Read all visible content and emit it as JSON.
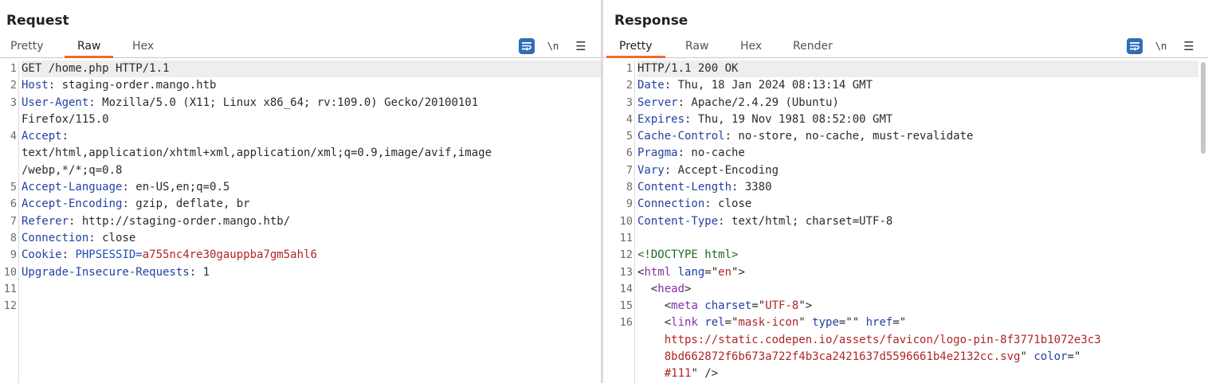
{
  "request": {
    "title": "Request",
    "tabs": [
      "Pretty",
      "Raw",
      "Hex"
    ],
    "active_tab": "Raw",
    "lines": [
      [
        {
          "t": "GET /home.php HTTP/1.1"
        }
      ],
      [
        {
          "t": "Host",
          "c": "hn"
        },
        {
          "t": ": staging-order.mango.htb"
        }
      ],
      [
        {
          "t": "User-Agent",
          "c": "hn"
        },
        {
          "t": ": Mozilla/5.0 (X11; Linux x86_64; rv:109.0) Gecko/20100101"
        }
      ],
      [
        {
          "t": "Firefox/115.0"
        }
      ],
      [
        {
          "t": "Accept",
          "c": "hn"
        },
        {
          "t": ":"
        }
      ],
      [
        {
          "t": "text/html,application/xhtml+xml,application/xml;q=0.9,image/avif,image"
        }
      ],
      [
        {
          "t": "/webp,*/*;q=0.8"
        }
      ],
      [
        {
          "t": "Accept-Language",
          "c": "hn"
        },
        {
          "t": ": en-US,en;q=0.5"
        }
      ],
      [
        {
          "t": "Accept-Encoding",
          "c": "hn"
        },
        {
          "t": ": gzip, deflate, br"
        }
      ],
      [
        {
          "t": "Referer",
          "c": "hn"
        },
        {
          "t": ": http://staging-order.mango.htb/"
        }
      ],
      [
        {
          "t": "Connection",
          "c": "hn"
        },
        {
          "t": ": close"
        }
      ],
      [
        {
          "t": "Cookie",
          "c": "hn"
        },
        {
          "t": ": "
        },
        {
          "t": "PHPSESSID",
          "c": "ck"
        },
        {
          "t": "=",
          "c": "ck"
        },
        {
          "t": "a755nc4re30gauppba7gm5ahl6",
          "c": "cv"
        }
      ],
      [
        {
          "t": "Upgrade-Insecure-Requests",
          "c": "hn"
        },
        {
          "t": ": 1"
        }
      ],
      [],
      []
    ],
    "line_numbers": [
      "1",
      "2",
      "3",
      "",
      "4",
      "",
      "",
      "5",
      "6",
      "7",
      "8",
      "9",
      "10",
      "11",
      "12"
    ]
  },
  "response": {
    "title": "Response",
    "tabs": [
      "Pretty",
      "Raw",
      "Hex",
      "Render"
    ],
    "active_tab": "Pretty",
    "lines": [
      [
        {
          "t": "HTTP/1.1 200 OK"
        }
      ],
      [
        {
          "t": "Date",
          "c": "hn"
        },
        {
          "t": ": Thu, 18 Jan 2024 08:13:14 GMT"
        }
      ],
      [
        {
          "t": "Server",
          "c": "hn"
        },
        {
          "t": ": Apache/2.4.29 (Ubuntu)"
        }
      ],
      [
        {
          "t": "Expires",
          "c": "hn"
        },
        {
          "t": ": Thu, 19 Nov 1981 08:52:00 GMT"
        }
      ],
      [
        {
          "t": "Cache-Control",
          "c": "hn"
        },
        {
          "t": ": no-store, no-cache, must-revalidate"
        }
      ],
      [
        {
          "t": "Pragma",
          "c": "hn"
        },
        {
          "t": ": no-cache"
        }
      ],
      [
        {
          "t": "Vary",
          "c": "hn"
        },
        {
          "t": ": Accept-Encoding"
        }
      ],
      [
        {
          "t": "Content-Length",
          "c": "hn"
        },
        {
          "t": ": 3380"
        }
      ],
      [
        {
          "t": "Connection",
          "c": "hn"
        },
        {
          "t": ": close"
        }
      ],
      [
        {
          "t": "Content-Type",
          "c": "hn"
        },
        {
          "t": ": text/html; charset=UTF-8"
        }
      ],
      [],
      [
        {
          "t": "<!DOCTYPE html>",
          "c": "dt"
        }
      ],
      [
        {
          "t": "<"
        },
        {
          "t": "html",
          "c": "tg"
        },
        {
          "t": " "
        },
        {
          "t": "lang",
          "c": "at"
        },
        {
          "t": "=\""
        },
        {
          "t": "en",
          "c": "av"
        },
        {
          "t": "\">"
        }
      ],
      [
        {
          "t": "  <"
        },
        {
          "t": "head",
          "c": "tg"
        },
        {
          "t": ">"
        }
      ],
      [
        {
          "t": "    <"
        },
        {
          "t": "meta",
          "c": "tg"
        },
        {
          "t": " "
        },
        {
          "t": "charset",
          "c": "at"
        },
        {
          "t": "=\""
        },
        {
          "t": "UTF-8",
          "c": "av"
        },
        {
          "t": "\">"
        }
      ],
      [
        {
          "t": "    <"
        },
        {
          "t": "link",
          "c": "tg"
        },
        {
          "t": " "
        },
        {
          "t": "rel",
          "c": "at"
        },
        {
          "t": "=\""
        },
        {
          "t": "mask-icon",
          "c": "av"
        },
        {
          "t": "\" "
        },
        {
          "t": "type",
          "c": "at"
        },
        {
          "t": "=\"\" "
        },
        {
          "t": "href",
          "c": "at"
        },
        {
          "t": "=\""
        }
      ],
      [
        {
          "t": "    "
        },
        {
          "t": "https://static.codepen.io/assets/favicon/logo-pin-8f3771b1072e3c3",
          "c": "av"
        }
      ],
      [
        {
          "t": "    "
        },
        {
          "t": "8bd662872f6b673a722f4b3ca2421637d5596661b4e2132cc.svg",
          "c": "av"
        },
        {
          "t": "\" "
        },
        {
          "t": "color",
          "c": "at"
        },
        {
          "t": "=\""
        }
      ],
      [
        {
          "t": "    "
        },
        {
          "t": "#111",
          "c": "av"
        },
        {
          "t": "\" />"
        }
      ]
    ],
    "line_numbers": [
      "1",
      "2",
      "3",
      "4",
      "5",
      "6",
      "7",
      "8",
      "9",
      "10",
      "11",
      "12",
      "13",
      "14",
      "15",
      "16",
      "",
      "",
      ""
    ]
  },
  "toolbar": {
    "wrap_icon": "word-wrap-icon",
    "newline_label": "\\n",
    "menu_icon": "hamburger-menu-icon"
  },
  "layout_toggle": [
    "side-by-side-layout-icon",
    "vertical-layout-icon",
    "single-pane-layout-icon"
  ],
  "colors": {
    "accent_tab": "#f16a2c",
    "button_blue": "#2f6eb6",
    "header_name": "#2241a3",
    "value_red": "#b12424"
  }
}
